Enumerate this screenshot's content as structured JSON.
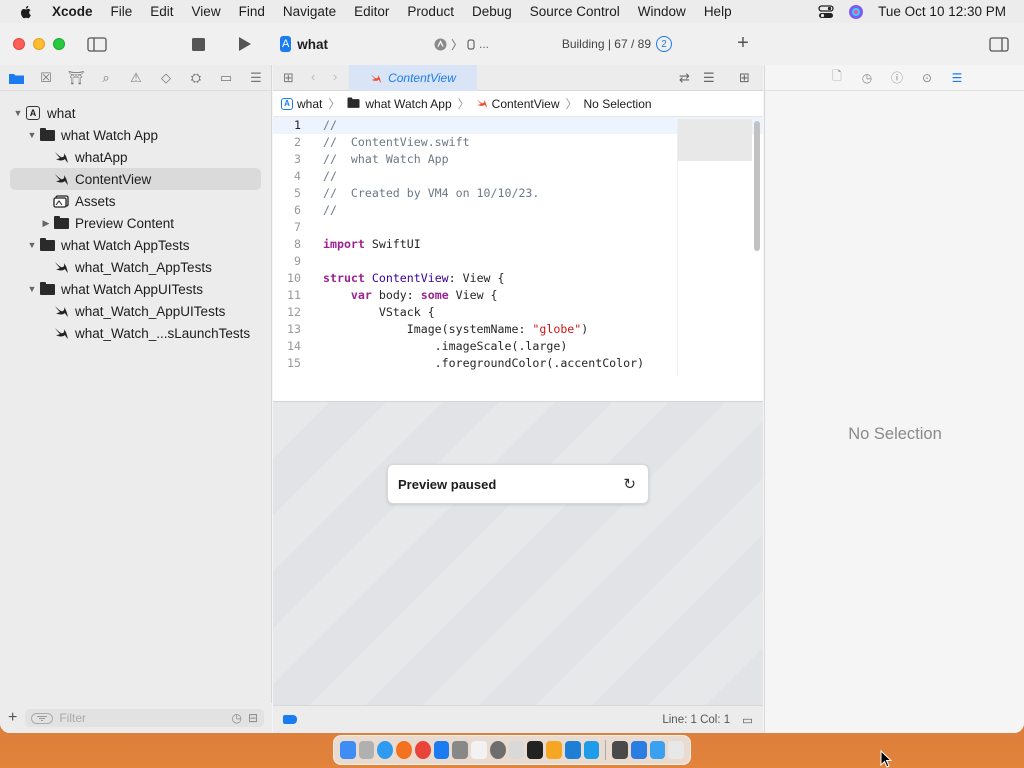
{
  "menubar": {
    "app": "Xcode",
    "items": [
      "File",
      "Edit",
      "View",
      "Find",
      "Navigate",
      "Editor",
      "Product",
      "Debug",
      "Source Control",
      "Window",
      "Help"
    ],
    "clock": "Tue Oct 10  12:30 PM"
  },
  "toolbar": {
    "scheme_name": "what",
    "destination": "...",
    "status": "Building | 67 / 89",
    "issue_count": "2"
  },
  "navigator": {
    "filter_placeholder": "Filter",
    "tree": [
      {
        "label": "what",
        "level": 0,
        "kind": "project",
        "disclosure": "open"
      },
      {
        "label": "what Watch App",
        "level": 1,
        "kind": "folder",
        "disclosure": "open"
      },
      {
        "label": "whatApp",
        "level": 2,
        "kind": "swift"
      },
      {
        "label": "ContentView",
        "level": 2,
        "kind": "swift",
        "selected": true
      },
      {
        "label": "Assets",
        "level": 2,
        "kind": "assets"
      },
      {
        "label": "Preview Content",
        "level": 2,
        "kind": "folder",
        "disclosure": "closed"
      },
      {
        "label": "what Watch AppTests",
        "level": 1,
        "kind": "folder",
        "disclosure": "open"
      },
      {
        "label": "what_Watch_AppTests",
        "level": 2,
        "kind": "swift"
      },
      {
        "label": "what Watch AppUITests",
        "level": 1,
        "kind": "folder",
        "disclosure": "open"
      },
      {
        "label": "what_Watch_AppUITests",
        "level": 2,
        "kind": "swift"
      },
      {
        "label": "what_Watch_...sLaunchTests",
        "level": 2,
        "kind": "swift"
      }
    ]
  },
  "editor": {
    "active_tab": "ContentView",
    "breadcrumb": [
      "what",
      "what Watch App",
      "ContentView",
      "No Selection"
    ],
    "lines": [
      {
        "n": "1",
        "html": "<span class=\"cmt\">//</span>"
      },
      {
        "n": "2",
        "html": "<span class=\"cmt\">//  ContentView.swift</span>"
      },
      {
        "n": "3",
        "html": "<span class=\"cmt\">//  what Watch App</span>"
      },
      {
        "n": "4",
        "html": "<span class=\"cmt\">//</span>"
      },
      {
        "n": "5",
        "html": "<span class=\"cmt\">//  Created by VM4 on 10/10/23.</span>"
      },
      {
        "n": "6",
        "html": "<span class=\"cmt\">//</span>"
      },
      {
        "n": "7",
        "html": ""
      },
      {
        "n": "8",
        "html": "<span class=\"kw\">import</span> SwiftUI"
      },
      {
        "n": "9",
        "html": ""
      },
      {
        "n": "10",
        "html": "<span class=\"kw\">struct</span> <span class=\"type\">ContentView</span>: View {"
      },
      {
        "n": "11",
        "html": "    <span class=\"kw\">var</span> body: <span class=\"kw\">some</span> View {"
      },
      {
        "n": "12",
        "html": "        VStack {"
      },
      {
        "n": "13",
        "html": "            Image(systemName: <span class=\"str\">\"globe\"</span>)"
      },
      {
        "n": "14",
        "html": "                .imageScale(.large)"
      },
      {
        "n": "15",
        "html": "                .foregroundColor(.accentColor)"
      }
    ],
    "preview_status": "Preview paused",
    "cursor_position": "Line: 1  Col: 1"
  },
  "inspector": {
    "empty_label": "No Selection"
  }
}
